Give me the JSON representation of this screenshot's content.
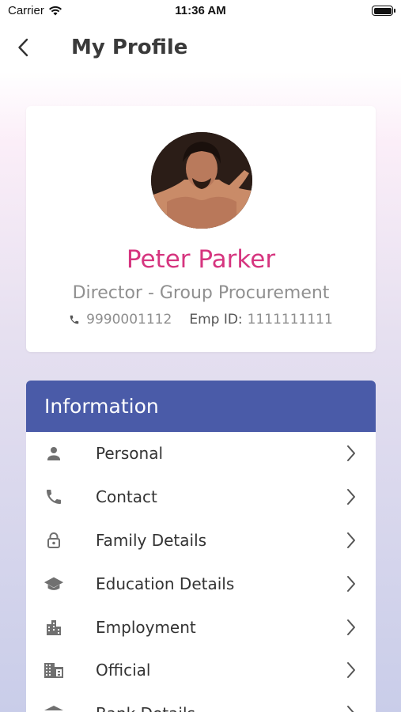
{
  "status_bar": {
    "carrier": "Carrier",
    "time": "11:36 AM"
  },
  "header": {
    "title": "My Profile",
    "back_icon": "chevron-left-icon"
  },
  "profile": {
    "name": "Peter Parker",
    "designation": "Director - Group Procurement",
    "phone": "9990001112",
    "emp_id_label": "Emp ID:",
    "emp_id": "1111111111",
    "name_color": "#d6357f"
  },
  "information": {
    "title": "Information",
    "header_color": "#4a5ba8",
    "items": [
      {
        "label": "Personal",
        "icon": "person-icon"
      },
      {
        "label": "Contact",
        "icon": "phone-icon"
      },
      {
        "label": "Family Details",
        "icon": "lock-icon"
      },
      {
        "label": "Education Details",
        "icon": "graduation-cap-icon"
      },
      {
        "label": "Employment",
        "icon": "city-icon"
      },
      {
        "label": "Official",
        "icon": "building-icon"
      },
      {
        "label": "Bank Details",
        "icon": "bank-icon"
      }
    ]
  }
}
